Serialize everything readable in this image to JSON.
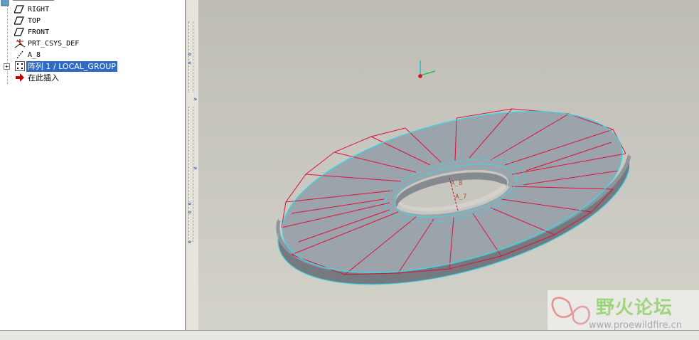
{
  "model_tree": {
    "items": [
      {
        "label": "RIGHT",
        "icon": "datum-plane-icon"
      },
      {
        "label": "TOP",
        "icon": "datum-plane-icon"
      },
      {
        "label": "FRONT",
        "icon": "datum-plane-icon"
      },
      {
        "label": "PRT_CSYS_DEF",
        "icon": "coordinate-system-icon"
      },
      {
        "label": "A_8",
        "icon": "datum-axis-icon"
      },
      {
        "label": "阵列 1 / LOCAL_GROUP",
        "icon": "pattern-icon",
        "selected": true,
        "expander": "+"
      },
      {
        "label": "在此插入",
        "icon": "insert-here-arrow-icon"
      }
    ]
  },
  "viewport": {
    "axis_labels": [
      "A_8",
      "A_7"
    ],
    "colors": {
      "background_top": "#bdbcb4",
      "background_bottom": "#d3d2c9",
      "part_face": "#9ba3ab",
      "edge_highlight": "#38d8e8",
      "section_lines": "#e0103c"
    }
  },
  "watermark": {
    "title": "野火论坛",
    "url": "www.proewildfire.cn"
  }
}
